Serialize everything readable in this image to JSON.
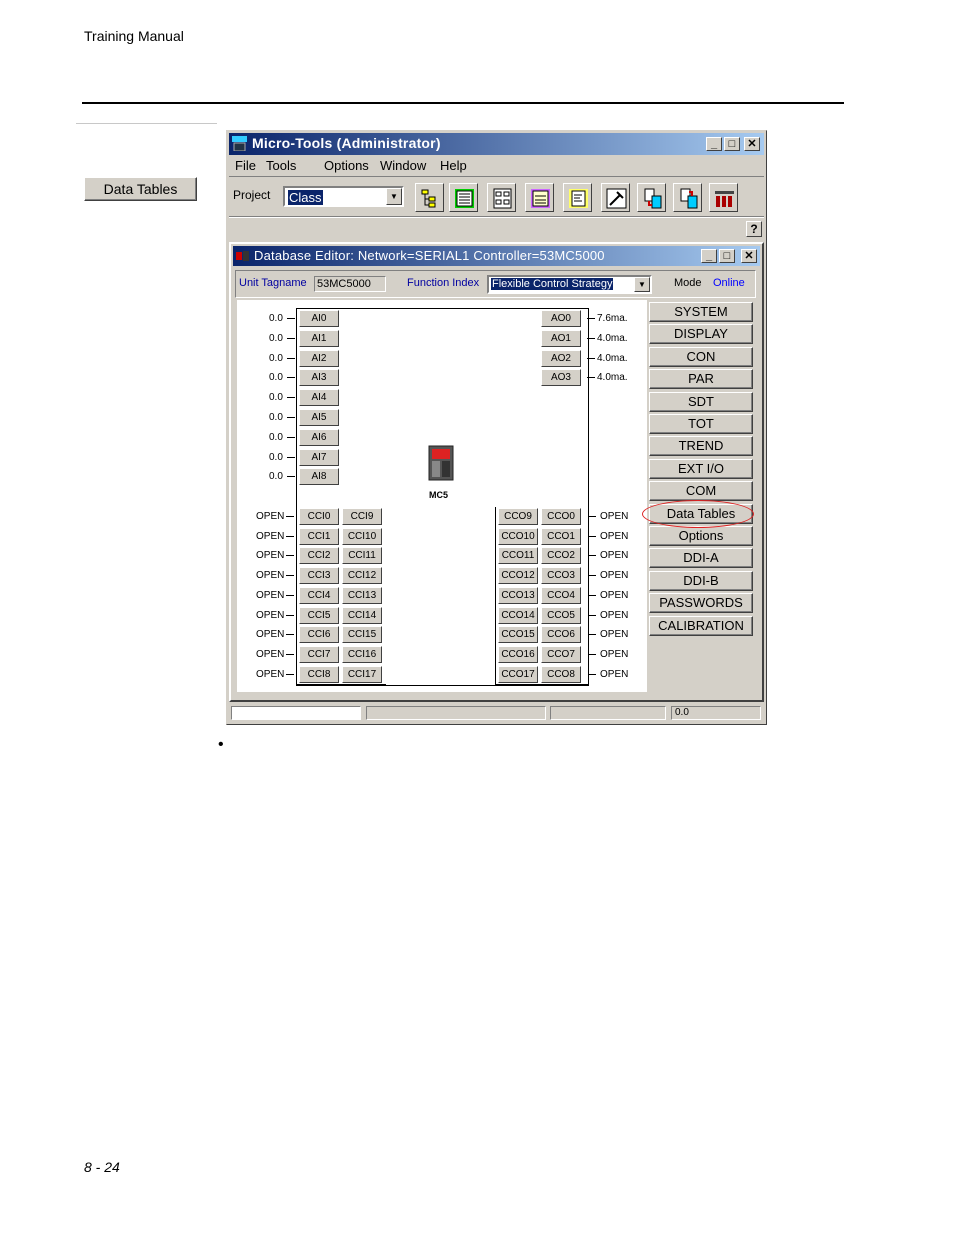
{
  "page": {
    "header": "Training Manual",
    "page_number": "8 - 24",
    "bullet": "•"
  },
  "side_button": {
    "label": "Data Tables"
  },
  "window": {
    "title": "Micro-Tools (Administrator)",
    "menu": [
      "File",
      "Tools",
      "Options",
      "Window",
      "Help"
    ],
    "project_label": "Project",
    "project_value": "Class",
    "help_label": "?",
    "tools": [
      "tree-tool-icon",
      "list-tool-icon",
      "grid-tool-icon",
      "form-tool-icon",
      "document-tool-icon",
      "hammer-tool-icon",
      "download-tool-icon",
      "upload-tool-icon",
      "rack-tool-icon"
    ]
  },
  "editor": {
    "title": "Database Editor: Network=SERIAL1  Controller=53MC5000",
    "unit_tagname_label": "Unit Tagname",
    "unit_tagname_value": "53MC5000",
    "function_index_label": "Function Index",
    "function_index_value": "Flexible Control Strategy",
    "mode_label": "Mode",
    "mode_value": "Online",
    "device_label": "MC5",
    "analog_inputs": [
      {
        "name": "AI0",
        "value": "0.0"
      },
      {
        "name": "AI1",
        "value": "0.0"
      },
      {
        "name": "AI2",
        "value": "0.0"
      },
      {
        "name": "AI3",
        "value": "0.0"
      },
      {
        "name": "AI4",
        "value": "0.0"
      },
      {
        "name": "AI5",
        "value": "0.0"
      },
      {
        "name": "AI6",
        "value": "0.0"
      },
      {
        "name": "AI7",
        "value": "0.0"
      },
      {
        "name": "AI8",
        "value": "0.0"
      }
    ],
    "analog_outputs": [
      {
        "name": "AO0",
        "value": "7.6ma."
      },
      {
        "name": "AO1",
        "value": "4.0ma."
      },
      {
        "name": "AO2",
        "value": "4.0ma."
      },
      {
        "name": "AO3",
        "value": "4.0ma."
      }
    ],
    "cci_left": [
      "CCI0",
      "CCI1",
      "CCI2",
      "CCI3",
      "CCI4",
      "CCI5",
      "CCI6",
      "CCI7",
      "CCI8"
    ],
    "cci_right": [
      "CCI9",
      "CCI10",
      "CCI11",
      "CCI12",
      "CCI13",
      "CCI14",
      "CCI15",
      "CCI16",
      "CCI17"
    ],
    "cco_left": [
      "CCO9",
      "CCO10",
      "CCO11",
      "CCO12",
      "CCO13",
      "CCO14",
      "CCO15",
      "CCO16",
      "CCO17"
    ],
    "cco_right": [
      "CCO0",
      "CCO1",
      "CCO2",
      "CCO3",
      "CCO4",
      "CCO5",
      "CCO6",
      "CCO7",
      "CCO8"
    ],
    "contact_state": "OPEN",
    "side_buttons": [
      "SYSTEM",
      "DISPLAY",
      "CON",
      "PAR",
      "SDT",
      "TOT",
      "TREND",
      "EXT I/O",
      "COM",
      "Data Tables",
      "Options",
      "DDI-A",
      "DDI-B",
      "PASSWORDS",
      "CALIBRATION"
    ],
    "highlighted_button": "Data Tables",
    "highlight_color": "#dd2222"
  },
  "status_bar": {
    "value": "0.0"
  }
}
